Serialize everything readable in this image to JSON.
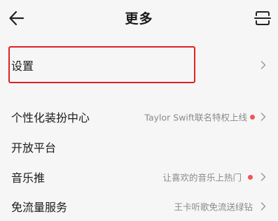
{
  "header": {
    "title": "更多",
    "back_icon": "arrow-left-icon",
    "scan_icon": "scan-icon"
  },
  "settings": {
    "label": "设置"
  },
  "menu": {
    "items": [
      {
        "label": "个性化装扮中心",
        "subtitle": "Taylor Swift联名特权上线",
        "red_dot": true
      },
      {
        "label": "开放平台",
        "subtitle": "",
        "red_dot": false
      },
      {
        "label": "音乐推",
        "subtitle": "让喜欢的音乐上热门",
        "red_dot": true
      },
      {
        "label": "免流量服务",
        "subtitle": "王卡听歌免流送绿钻",
        "red_dot": false
      }
    ]
  },
  "colors": {
    "background": "#f6f6f6",
    "red_dot": "#f0555b",
    "highlight": "#e22020"
  }
}
